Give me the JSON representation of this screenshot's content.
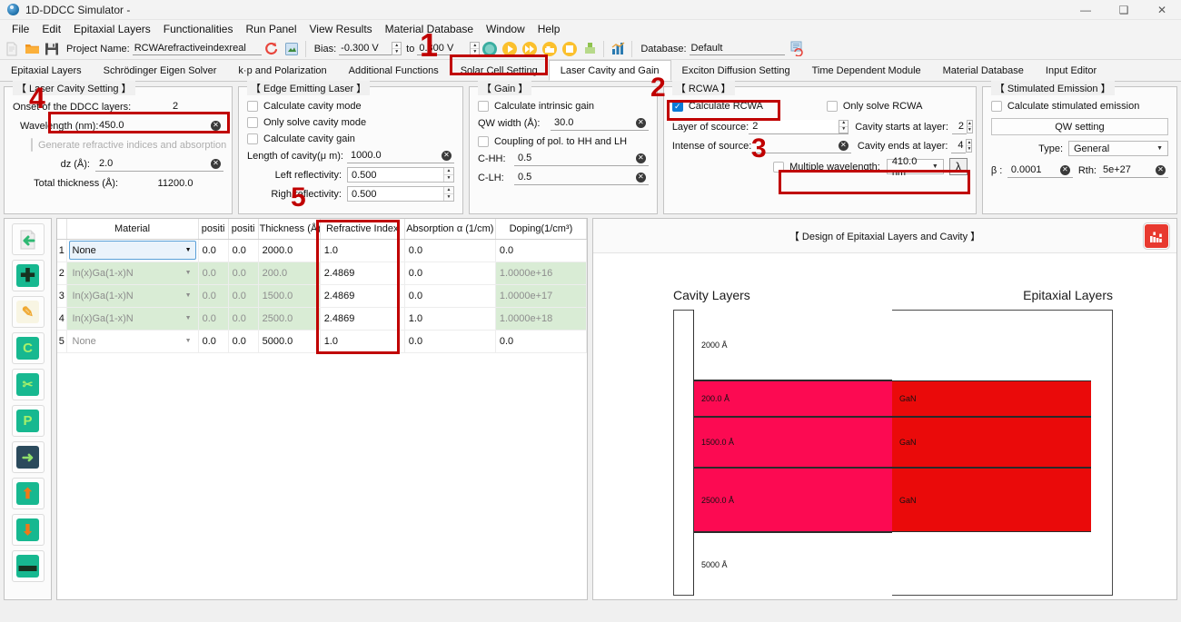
{
  "window": {
    "title": "1D-DDCC Simulator -",
    "minimize": "—",
    "maximize": "❑",
    "close": "✕"
  },
  "menubar": {
    "items": [
      "File",
      "Edit",
      "Epitaxial Layers",
      "Functionalities",
      "Run Panel",
      "View Results",
      "Material Database",
      "Window",
      "Help"
    ]
  },
  "toolbar": {
    "project_label": "Project Name:",
    "project_value": "RCWArefractiveindexreal",
    "bias_label": "Bias:",
    "bias_from": "-0.300 V",
    "bias_to_label": "to",
    "bias_to": "0.300 V",
    "database_label": "Database:",
    "database_value": "Default"
  },
  "tabs": {
    "items": [
      "Epitaxial Layers",
      "Schrödinger Eigen Solver",
      "k·p and Polarization",
      "Additional Functions",
      "Solar Cell Setting",
      "Laser Cavity and Gain",
      "Exciton Diffusion Setting",
      "Time Dependent Module",
      "Material Database",
      "Input Editor"
    ],
    "active": "Laser Cavity and Gain"
  },
  "laser_cavity": {
    "title": "【 Laser Cavity Setting 】",
    "onset_label": "Onset of the DDCC layers:",
    "onset_value": "2",
    "wavelength_label": "Wavelength (nm):",
    "wavelength_value": "450.0",
    "generate_label": "Generate refractive indices and absorption",
    "dz_label": "dz (Å):",
    "dz_value": "2.0",
    "total_thickness_label": "Total thickness (Å):",
    "total_thickness_value": "11200.0"
  },
  "edge_emitting": {
    "title": "【 Edge Emitting Laser 】",
    "cb_calculate_cavity_mode": "Calculate cavity mode",
    "cb_only_solve_cavity_mode": "Only solve cavity mode",
    "cb_calculate_cavity_gain": "Calculate cavity gain",
    "length_label": "Length of cavity(μ m):",
    "length_value": "1000.0",
    "left_refl_label": "Left reflectivity:",
    "left_refl_value": "0.500",
    "right_refl_label": "Righ  reflectivity:",
    "right_refl_value": "0.500"
  },
  "gain": {
    "title": "【 Gain 】",
    "cb_calculate_intrinsic_gain": "Calculate intrinsic gain",
    "qw_width_label": "QW width (Å):",
    "qw_width_value": "30.0",
    "cb_coupling": "Coupling of pol. to HH and LH",
    "chh_label": "C-HH:",
    "chh_value": "0.5",
    "clh_label": "C-LH:",
    "clh_value": "0.5"
  },
  "rcwa": {
    "title": "【 RCWA 】",
    "cb_calculate_rcwa": "Calculate RCWA",
    "cb_calculate_rcwa_checked": true,
    "cb_only_solve_rcwa": "Only solve RCWA",
    "layer_of_source_label": "Layer of scource:",
    "layer_of_source_value": "2",
    "cavity_starts_label": "Cavity starts at layer:",
    "cavity_starts_value": "2",
    "intense_of_source_label": "Intense of source:",
    "intense_of_source_value": "",
    "cavity_ends_label": "Cavity ends at layer:",
    "cavity_ends_value": "4",
    "cb_multiple_wavelength": "Multiple wavelength:",
    "multiple_wavelength_value": "410.0 nm",
    "lambda_button": "λ"
  },
  "stimulated_emission": {
    "title": "【 Stimulated Emission 】",
    "cb_calculate": "Calculate stimulated emission",
    "qw_setting_button": "QW setting",
    "type_label": "Type:",
    "type_value": "General",
    "beta_label": "β :",
    "beta_value": "0.0001",
    "rth_label": "Rth:",
    "rth_value": "5e+27"
  },
  "sidebar_icons": [
    {
      "name": "import-layer",
      "glyph": "←",
      "bg": "#e8e8e8",
      "fg": "#2eb872"
    },
    {
      "name": "add-layer",
      "glyph": "✚",
      "bg": "#17b890",
      "fg": "#1c2b33"
    },
    {
      "name": "edit-layer",
      "glyph": "✎",
      "bg": "#f7f4e2",
      "fg": "#f0a830"
    },
    {
      "name": "copy-layer",
      "glyph": "C",
      "bg": "#17b890",
      "fg": "#9ff06a"
    },
    {
      "name": "cut-layer",
      "glyph": "✂",
      "bg": "#17b890",
      "fg": "#9ff06a"
    },
    {
      "name": "paste-layer",
      "glyph": "P",
      "bg": "#17b890",
      "fg": "#9ff06a"
    },
    {
      "name": "insert-layer",
      "glyph": "→",
      "bg": "#2b4a5c",
      "fg": "#8fe06a"
    },
    {
      "name": "move-layer-up",
      "glyph": "↑",
      "bg": "#17b890",
      "fg": "#f07818"
    },
    {
      "name": "move-layer-down",
      "glyph": "↓",
      "bg": "#17b890",
      "fg": "#f07818"
    },
    {
      "name": "remove-layer",
      "glyph": "−",
      "bg": "#17b890",
      "fg": "#1c2b33"
    }
  ],
  "layer_table": {
    "headers": [
      "Material",
      "positi",
      "positi",
      "Thickness (Å)",
      "Refractive Index",
      "Absorption α (1/cm)",
      "Doping(1/cm³)"
    ],
    "rows": [
      {
        "n": "1",
        "material": "None",
        "pos1": "0.0",
        "pos2": "0.0",
        "thickness": "2000.0",
        "refractive": "1.0",
        "absorption": "0.0",
        "doping": "0.0",
        "highlight": false,
        "selected": true
      },
      {
        "n": "2",
        "material": "In(x)Ga(1-x)N",
        "pos1": "0.0",
        "pos2": "0.0",
        "thickness": "200.0",
        "refractive": "2.4869",
        "absorption": "0.0",
        "doping": "1.0000e+16",
        "highlight": true,
        "selected": false
      },
      {
        "n": "3",
        "material": "In(x)Ga(1-x)N",
        "pos1": "0.0",
        "pos2": "0.0",
        "thickness": "1500.0",
        "refractive": "2.4869",
        "absorption": "0.0",
        "doping": "1.0000e+17",
        "highlight": true,
        "selected": false
      },
      {
        "n": "4",
        "material": "In(x)Ga(1-x)N",
        "pos1": "0.0",
        "pos2": "0.0",
        "thickness": "2500.0",
        "refractive": "2.4869",
        "absorption": "1.0",
        "doping": "1.0000e+18",
        "highlight": true,
        "selected": false
      },
      {
        "n": "5",
        "material": "None",
        "pos1": "0.0",
        "pos2": "0.0",
        "thickness": "5000.0",
        "refractive": "1.0",
        "absorption": "0.0",
        "doping": "0.0",
        "highlight": false,
        "selected": false
      }
    ]
  },
  "viz": {
    "title": "【 Design of Epitaxial Layers and Cavity 】",
    "cavity_label": "Cavity Layers",
    "epitaxial_label": "Epitaxial Layers",
    "cavity_layers": [
      {
        "thickness": "2000 Å",
        "color": "#ffffff",
        "epi_color": "none",
        "epi_label": ""
      },
      {
        "thickness": "200.0 Å",
        "color": "#fc0a52",
        "epi_color": "#ea0a0a",
        "epi_label": "GaN"
      },
      {
        "thickness": "1500.0 Å",
        "color": "#fc0a52",
        "epi_color": "#ea0a0a",
        "epi_label": "GaN"
      },
      {
        "thickness": "2500.0 Å",
        "color": "#fc0a52",
        "epi_color": "#ea0a0a",
        "epi_label": "GaN"
      },
      {
        "thickness": "5000 Å",
        "color": "#ffffff",
        "epi_color": "none",
        "epi_label": ""
      }
    ]
  },
  "annotations": {
    "markers": [
      "1",
      "2",
      "3",
      "4",
      "5"
    ]
  },
  "colors": {
    "accent_red": "#c00000",
    "checkbox_blue": "#0a7ad6",
    "row_highlight_green": "#d9ecd5",
    "cavity_pink": "#fc0a52",
    "epi_red": "#ea0a0a"
  }
}
